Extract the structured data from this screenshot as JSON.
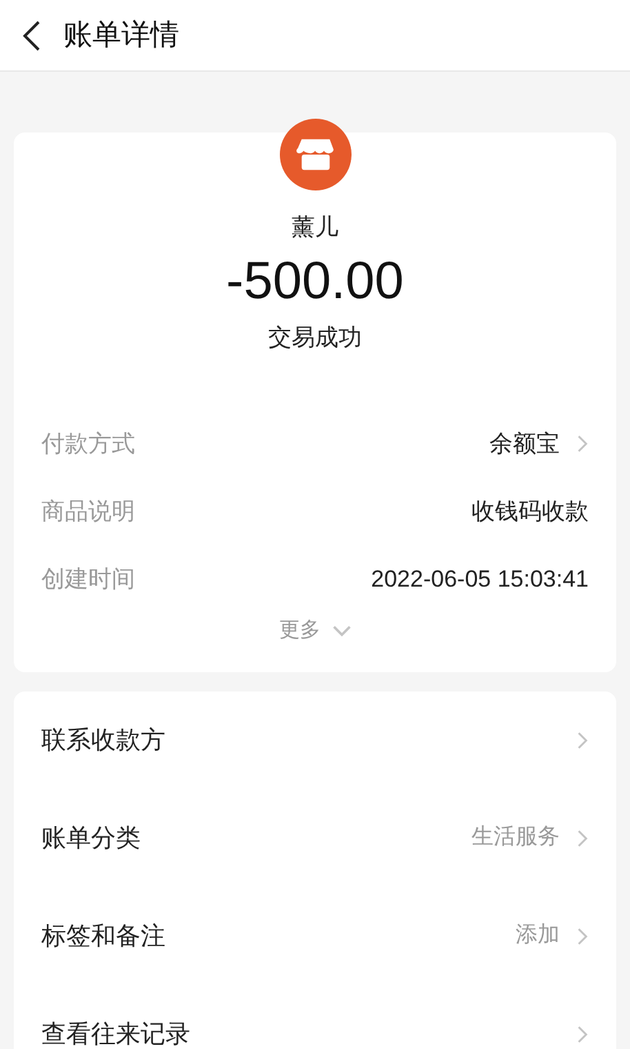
{
  "header": {
    "title": "账单详情"
  },
  "bill": {
    "merchant": "薰儿",
    "amount": "-500.00",
    "status": "交易成功",
    "details": [
      {
        "label": "付款方式",
        "value": "余额宝",
        "link": true
      },
      {
        "label": "商品说明",
        "value": "收钱码收款",
        "link": false
      },
      {
        "label": "创建时间",
        "value": "2022-06-05 15:03:41",
        "link": false
      }
    ],
    "more": "更多"
  },
  "actions": [
    {
      "label": "联系收款方"
    },
    {
      "label": "账单分类",
      "value": "生活服务"
    },
    {
      "label": "标签和备注",
      "value": "添加"
    },
    {
      "label": "查看往来记录"
    }
  ]
}
